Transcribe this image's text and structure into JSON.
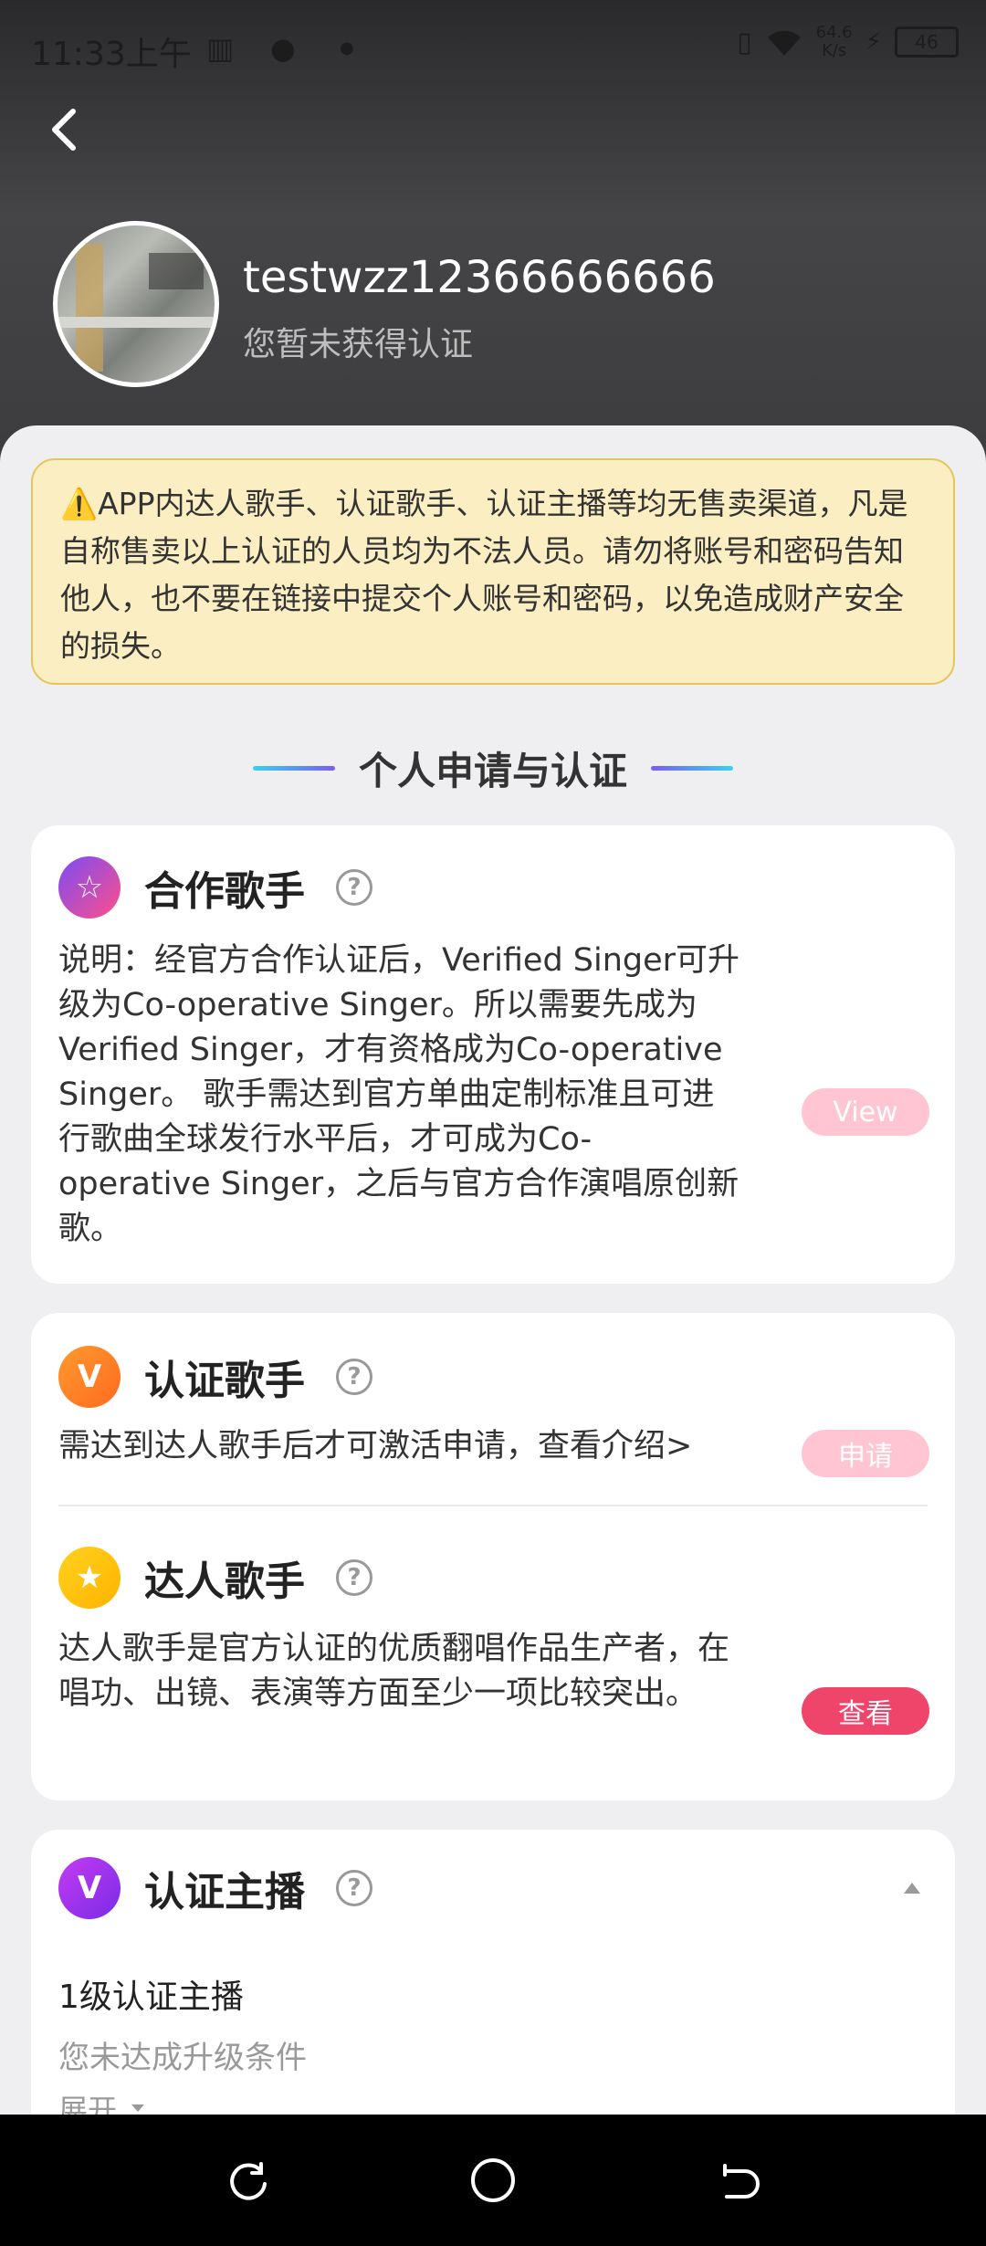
{
  "status_bar": {
    "time": "11:33上午",
    "net_speed": "64.6\nK/s",
    "battery": "46"
  },
  "profile": {
    "username": "testwzz12366666666",
    "cert_status": "您暂未获得认证"
  },
  "notice": "⚠️APP内达人歌手、认证歌手、认证主播等均无售卖渠道，凡是自称售卖以上认证的人员均为不法人员。请勿将账号和密码告知他人，也不要在链接中提交个人账号和密码，以免造成财产安全的损失。",
  "section_title": "个人申请与认证",
  "cooperative": {
    "title": "合作歌手",
    "help": "?",
    "description": "说明：经官方合作认证后，Verified Singer可升级为Co-operative Singer。所以需要先成为Verified Singer，才有资格成为Co-operative Singer。 歌手需达到官方单曲定制标准且可进行歌曲全球发行水平后，才可成为Co-operative Singer，之后与官方合作演唱原创新歌。",
    "button": "View"
  },
  "verified_singer": {
    "title": "认证歌手",
    "help": "?",
    "description": "需达到达人歌手后才可激活申请，查看介绍>",
    "button": "申请"
  },
  "talent_singer": {
    "title": "达人歌手",
    "help": "?",
    "description": "达人歌手是官方认证的优质翻唱作品生产者，在唱功、出镜、表演等方面至少一项比较突出。",
    "button": "查看"
  },
  "anchor": {
    "title": "认证主播",
    "help": "?",
    "level_title": "1级认证主播",
    "level_status": "您未达成升级条件",
    "expand": "展开"
  },
  "icons": {
    "back": "chevron-left-icon",
    "cooperative_badge": "star-hexagon-icon",
    "verified_badge": "v-badge-icon",
    "talent_badge": "star-badge-icon",
    "anchor_badge": "v-hexagon-icon"
  },
  "colors": {
    "accent_pink": "#f0456b",
    "disabled_pink": "#ffc5d2",
    "notice_bg": "#fbeec3"
  }
}
